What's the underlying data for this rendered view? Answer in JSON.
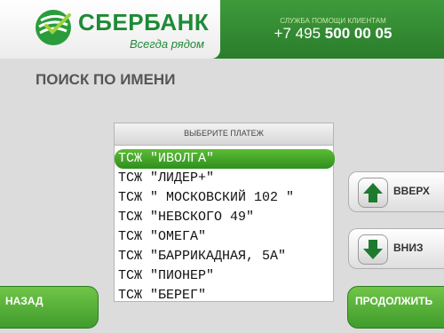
{
  "header": {
    "brand_name": "СБЕРБАНК",
    "slogan": "Всегда рядом",
    "helpline_title": "СЛУЖБА ПОМОЩИ КЛИЕНТАМ",
    "phone_prefix": "+7 495 ",
    "phone_main": "500 00 05"
  },
  "page": {
    "title": "ПОИСК ПО ИМЕНИ"
  },
  "list": {
    "header": "ВЫБЕРИТЕ ПЛАТЕЖ",
    "selected_index": 0,
    "items": [
      "ТСЖ \"ИВОЛГА\"",
      "ТСЖ \"ЛИДЕР+\"",
      "ТСЖ \" МОСКОВСКИЙ 102 \"",
      "ТСЖ \"НЕВСКОГО 49\"",
      "ТСЖ \"ОМЕГА\"",
      "ТСЖ \"БАРРИКАДНАЯ, 5А\"",
      "ТСЖ \"ПИОНЕР\"",
      "ТСЖ \"БЕРЕГ\""
    ]
  },
  "scroll": {
    "up_label": "ВВЕРХ",
    "down_label": "ВНИЗ"
  },
  "actions": {
    "back_label": "НАЗАД",
    "next_label": "ПРОДОЛЖИТЬ"
  },
  "colors": {
    "brand_green": "#1f8a36",
    "header_green": "#2f8a2f",
    "selection_green": "#3fa428"
  },
  "icons": {
    "logo": "sberbank-logo-icon",
    "up": "arrow-up-icon",
    "down": "arrow-down-icon"
  }
}
